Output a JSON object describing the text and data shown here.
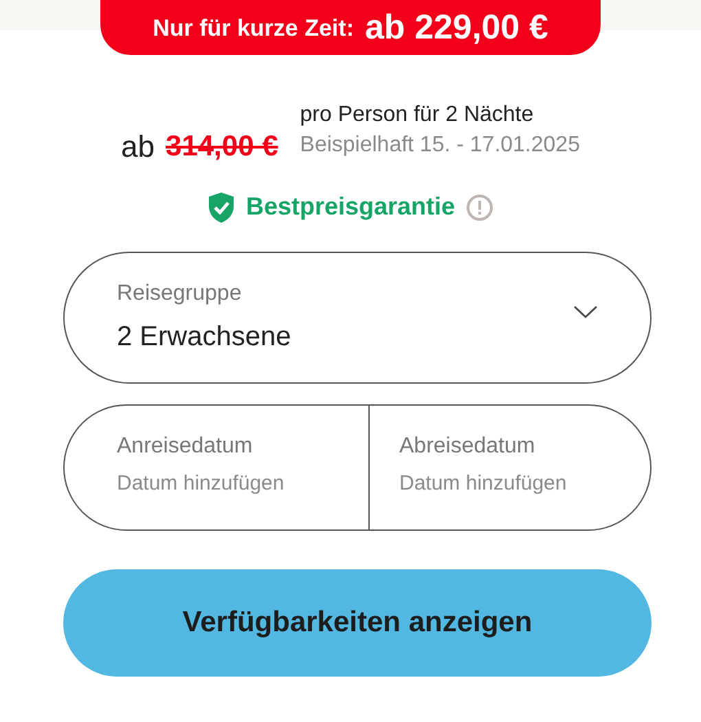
{
  "promo": {
    "label": "Nur für kurze Zeit:",
    "price": "ab 229,00 €"
  },
  "price": {
    "prefix": "ab",
    "old_price": "314,00 €",
    "per_person": "pro Person für 2 Nächte",
    "example_dates": "Beispielhaft 15. - 17.01.2025"
  },
  "guarantee": {
    "label": "Bestpreisgarantie"
  },
  "travel_group": {
    "label": "Reisegruppe",
    "value": "2 Erwachsene"
  },
  "dates": [
    {
      "label": "Anreisedatum",
      "placeholder": "Datum hinzufügen"
    },
    {
      "label": "Abreisedatum",
      "placeholder": "Datum hinzufügen"
    }
  ],
  "submit": {
    "label": "Verfügbarkeiten anzeigen"
  }
}
